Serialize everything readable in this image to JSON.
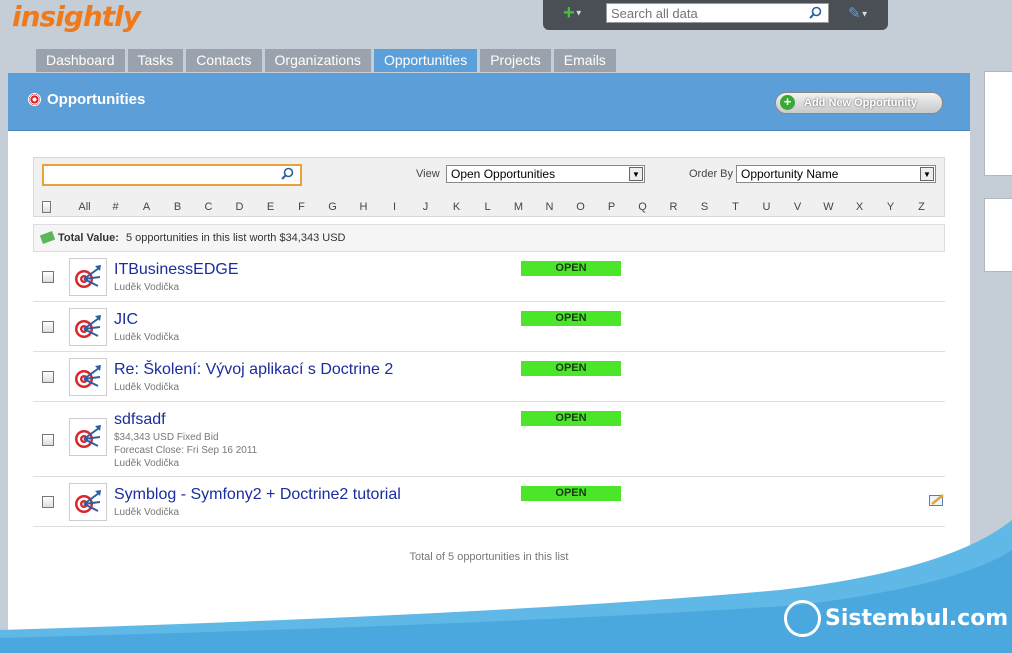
{
  "app": {
    "logo": "insightly"
  },
  "topbar": {
    "plus_icon": "plus-icon",
    "search_placeholder": "Search all data",
    "pin_icon": "pin-icon"
  },
  "tabs": [
    {
      "label": "Dashboard",
      "active": false
    },
    {
      "label": "Tasks",
      "active": false
    },
    {
      "label": "Contacts",
      "active": false
    },
    {
      "label": "Organizations",
      "active": false
    },
    {
      "label": "Opportunities",
      "active": true
    },
    {
      "label": "Projects",
      "active": false
    },
    {
      "label": "Emails",
      "active": false
    }
  ],
  "header": {
    "title": "Opportunities",
    "add_button": "Add New Opportunity"
  },
  "filters": {
    "search_value": "",
    "view_label": "View",
    "view_value": "Open Opportunities",
    "order_label": "Order By",
    "order_value": "Opportunity Name",
    "alphabet": [
      "All",
      "#",
      "A",
      "B",
      "C",
      "D",
      "E",
      "F",
      "G",
      "H",
      "I",
      "J",
      "K",
      "L",
      "M",
      "N",
      "O",
      "P",
      "Q",
      "R",
      "S",
      "T",
      "U",
      "V",
      "W",
      "X",
      "Y",
      "Z"
    ]
  },
  "total": {
    "label": "Total Value:",
    "text": "5 opportunities in this list worth $34,343 USD"
  },
  "opportunities": [
    {
      "name": "ITBusinessEDGE",
      "details": [
        "Luděk Vodička"
      ],
      "status": "OPEN"
    },
    {
      "name": "JIC",
      "details": [
        "Luděk Vodička"
      ],
      "status": "OPEN"
    },
    {
      "name": "Re: Školení: Vývoj aplikací s Doctrine 2",
      "details": [
        "Luděk Vodička"
      ],
      "status": "OPEN"
    },
    {
      "name": "sdfsadf",
      "details": [
        "$34,343 USD Fixed Bid",
        "Forecast Close: Fri Sep 16 2011",
        "Luděk Vodička"
      ],
      "status": "OPEN"
    },
    {
      "name": "Symblog - Symfony2 + Doctrine2 tutorial",
      "details": [
        "Luděk Vodička"
      ],
      "status": "OPEN"
    }
  ],
  "footer": {
    "text": "Total of 5 opportunities in this list"
  },
  "watermark": {
    "text": "Sistembul.com"
  },
  "colors": {
    "accent": "#5c9fd8",
    "open_status": "#4be52a",
    "link": "#1a2c9e",
    "logo": "#f07a1a"
  }
}
